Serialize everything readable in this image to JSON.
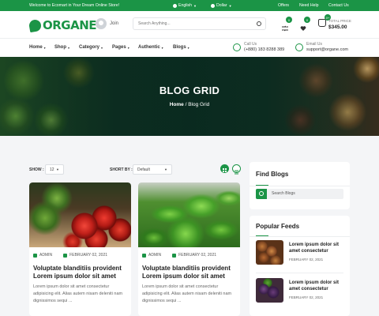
{
  "topbar": {
    "welcome": "Welcome to Ecomart in Your Dream Online Store!",
    "language": "English",
    "currency": "Dollar",
    "links": [
      "Offers",
      "Need Help",
      "Contact Us"
    ]
  },
  "header": {
    "logo": "ORGANE",
    "join": "Join",
    "search_placeholder": "Search Anything...",
    "badges": {
      "compare": "0",
      "wishlist": "0",
      "cart": "0+"
    },
    "total_label": "TOTAL PRICE",
    "total_value": "$345.00"
  },
  "nav": {
    "items": [
      "Home",
      "Shop",
      "Category",
      "Pages",
      "Authentic",
      "Blogs"
    ],
    "call_label": "Call Us",
    "call_value": "(+880) 183 8288 389",
    "email_label": "Email Us",
    "email_value": "support@organe.com"
  },
  "banner": {
    "title": "BLOG GRID",
    "crumb_home": "Home",
    "crumb_sep": "/",
    "crumb_current": "Blog Grid"
  },
  "toolbar": {
    "show_label": "SHOW :",
    "show_value": "12",
    "sort_label": "SHORT BY :",
    "sort_value": "Default"
  },
  "posts": [
    {
      "author": "ADMIN",
      "date": "FEBRUARY 02, 2021",
      "title": "Voluptate blanditiis provident Lorem ipsum dolor sit amet",
      "excerpt": "Lorem ipsum dolor sit amet consectetur adipisicing elit. Alias autem nisam deleniti nam dignissimos sequi ..."
    },
    {
      "author": "ADMIN",
      "date": "FEBRUARY 02, 2021",
      "title": "Voluptate blanditiis provident Lorem ipsum dolor sit amet",
      "excerpt": "Lorem ipsum dolor sit amet consectetur adipisicing elit. Alias autem nisam deleniti nam dignissimos sequi ..."
    }
  ],
  "sidebar": {
    "find_title": "Find Blogs",
    "search_placeholder": "Search Blogs",
    "popular_title": "Popular Feeds",
    "feeds": [
      {
        "title": "Lorem ipsum dolor sit amet consectetur",
        "date": "FEBRUARY 02, 2021"
      },
      {
        "title": "Lorem ipsum dolor sit amet consectetur",
        "date": "FEBRUARY 02, 2021"
      }
    ]
  },
  "colors": {
    "brand": "#1b9446",
    "background": "#f4f5f7"
  }
}
